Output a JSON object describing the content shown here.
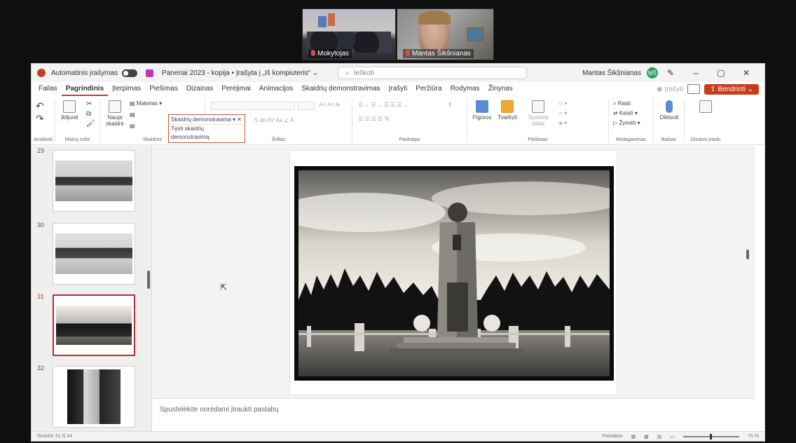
{
  "video": {
    "participant1": "Mokytojas",
    "participant2": "Mantas Šikšnianas"
  },
  "window": {
    "autosave_label": "Automatinis įrašymas",
    "doc_title": "Paneriai 2023 - kopija • Įrašyta į „Iš kompiuteris“ ⌄",
    "search_placeholder": "Ieškoti",
    "user_name": "Mantas Šikšnianas",
    "avatar_initials": "MŠ"
  },
  "tabs": [
    "Failas",
    "Pagrindinis",
    "Įterpimas",
    "Piešimas",
    "Dizainas",
    "Perėjimai",
    "Animacijos",
    "Skaidrių demonstravimas",
    "Įrašyti",
    "Peržiūra",
    "Rodymas",
    "Žinynas"
  ],
  "active_tab": "Pagrindinis",
  "ribbon_right": {
    "record_label": "Įrašyti",
    "share_label": "Bendrinti"
  },
  "ribbon": {
    "undo_group": "Anuliuoti",
    "clipboard": {
      "paste": "Įklijuoti",
      "label": "Mainų sritis"
    },
    "slides": {
      "new_slide": "Nauja skaidrė",
      "layout": "Maketas",
      "label": "Skaidrės"
    },
    "font": {
      "label": "Šriftas"
    },
    "paragraph": {
      "label": "Pastraipa"
    },
    "drawing": {
      "shapes": "Figūros",
      "arrange": "Tvarkyti",
      "quick_styles": "Spartieji stiliai",
      "label": "Piešimas"
    },
    "editing": {
      "find": "Rasti",
      "replace": "Keisti",
      "select": "Žymėti",
      "label": "Redagavimas"
    },
    "voice": {
      "dictate": "Diktuoti",
      "label": "Balsas"
    },
    "designer": {
      "label": "Dizaino įranki"
    }
  },
  "dropdown": {
    "item1": "Skaidrių demonstravima ▾ ✕",
    "item2": "Tęsti skaidrių demonstravimą"
  },
  "thumbnails": [
    {
      "number": "29"
    },
    {
      "number": "30"
    },
    {
      "number": "31"
    },
    {
      "number": "32"
    }
  ],
  "notes_placeholder": "Spustelėkite norėdami įtraukti pastabų",
  "status": {
    "slide_info": "Skaidrė 31 iš 44",
    "notes_button": "Pastabos",
    "zoom": "75 %"
  }
}
